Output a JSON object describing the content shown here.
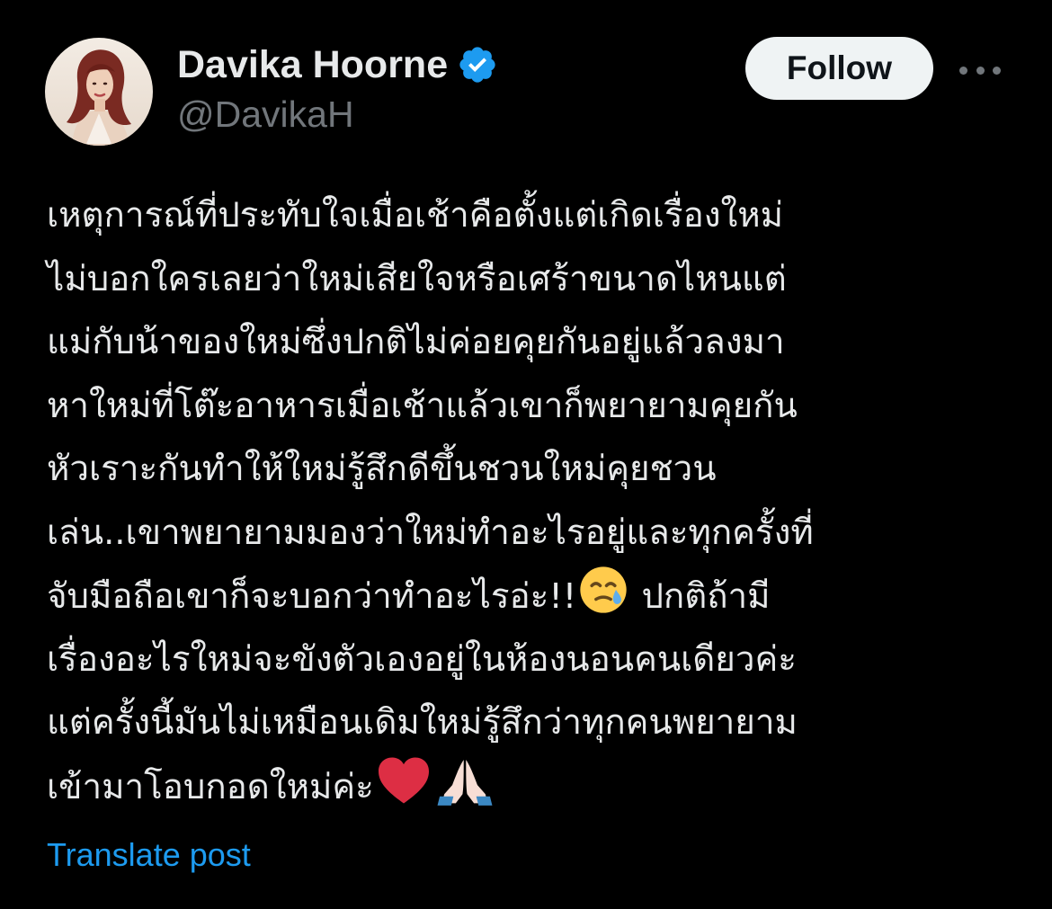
{
  "author": {
    "display_name": "Davika Hoorne",
    "handle": "@DavikaH",
    "verified": true
  },
  "actions": {
    "follow_label": "Follow",
    "more_icon": "more-horizontal-icon"
  },
  "post": {
    "lines": [
      "เหตุการณ์ที่ประทับใจเมื่อเช้าคือตั้งแต่เกิดเรื่องใหม่",
      "ไม่บอกใครเลยว่าใหม่เสียใจหรือเศร้าขนาดไหนแต่",
      "แม่กับน้าของใหม่ซึ่งปกติไม่ค่อยคุยกันอยู่แล้วลงมา",
      "หาใหม่ที่โต๊ะอาหารเมื่อเช้าแล้วเขาก็พยายามคุยกัน",
      "หัวเราะกันทำให้ใหม่รู้สึกดีขึ้นชวนใหม่คุยชวน",
      "เล่น..เขาพยายามมองว่าใหม่ทำอะไรอยู่และทุกครั้งที่",
      "จับมือถือเขาก็จะบอกว่าทำอะไรอ่ะ!!",
      "ปกติถ้ามี",
      "เรื่องอะไรใหม่จะขังตัวเองอยู่ในห้องนอนคนเดียวค่ะ",
      "แต่ครั้งนี้มันไม่เหมือนเดิมใหม่รู้สึกว่าทุกคนพยายาม",
      "เข้ามาโอบกอดใหม่ค่ะ"
    ],
    "emojis": [
      "crying-face-emoji",
      "red-heart-emoji",
      "folded-hands-emoji"
    ]
  },
  "footer": {
    "translate_label": "Translate post"
  },
  "colors": {
    "background": "#000000",
    "text": "#e7e9ea",
    "secondary": "#71767b",
    "link": "#1d9bf0",
    "verified": "#1d9bf0",
    "button_bg": "#eff3f4"
  }
}
